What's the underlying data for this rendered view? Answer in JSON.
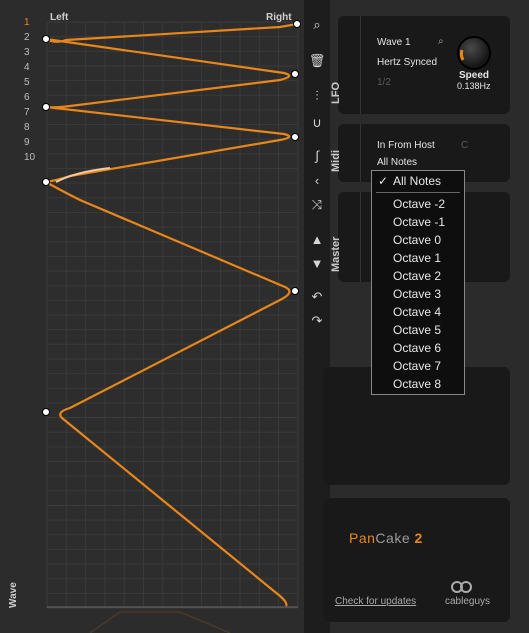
{
  "editor": {
    "header_left": "Left",
    "header_right": "Right",
    "row_numbers": [
      "1",
      "2",
      "3",
      "4",
      "5",
      "6",
      "7",
      "8",
      "9",
      "10"
    ],
    "active_row": "1",
    "wave_label": "Wave",
    "curve_color": "#e8861a"
  },
  "tools": {
    "search": "search-icon",
    "delete": "trash-icon",
    "link": "node-link-icon",
    "curve": "curve-icon",
    "s_curve": "s-curve-icon",
    "angle": "angle-icon",
    "random": "shuffle-icon",
    "up": "arrow-up-icon",
    "down": "arrow-down-icon",
    "undo": "undo-icon",
    "redo": "redo-icon"
  },
  "lfo": {
    "tab": "LFO",
    "wave": "Wave 1",
    "sync": "Hertz Synced",
    "rate": "1/2",
    "knob_label": "Speed",
    "knob_value": "0.138Hz"
  },
  "midi": {
    "tab": "Midi",
    "input": "In From Host",
    "notes": "All Notes",
    "channel_hint": "C"
  },
  "master": {
    "tab": "Master"
  },
  "dropdown": {
    "selected": "All Notes",
    "check": "✓",
    "options": [
      "Octave -2",
      "Octave -1",
      "Octave 0",
      "Octave 1",
      "Octave 2",
      "Octave 3",
      "Octave 4",
      "Octave 5",
      "Octave 6",
      "Octave 7",
      "Octave 8"
    ]
  },
  "brand": {
    "name_part1": "Pan",
    "name_part2": "Cake",
    "version": "2",
    "update_link": "Check for updates",
    "company": "cableguys"
  }
}
